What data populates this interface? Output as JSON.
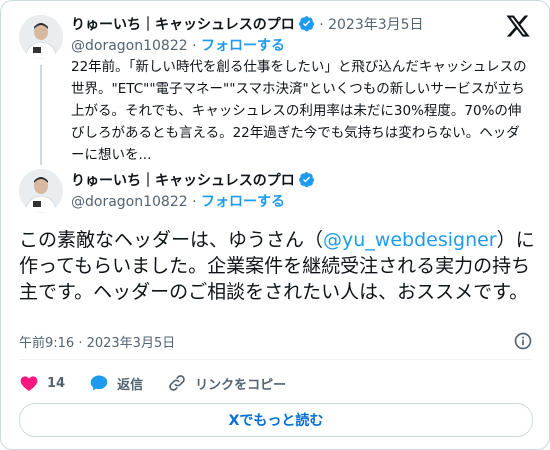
{
  "quoted": {
    "name": "りゅーいち｜キャッシュレスのプロ",
    "timestamp": "2023年3月5日",
    "handle": "@doragon10822",
    "follow_label": "フォローする",
    "text": "22年前。「新しい時代を創る仕事をしたい」と飛び込んだキャッシュレスの世界。\"ETC\"\"電子マネー\"\"スマホ決済\"といくつもの新しいサービスが立ち上がる。それでも、キャッシュレスの利用率は未だに30%程度。70%の伸びしろがあるとも言える。22年過ぎた今でも気持ちは変わらない。ヘッダーに想いを..."
  },
  "main": {
    "name": "りゅーいち｜キャッシュレスのプロ",
    "handle": "@doragon10822",
    "follow_label": "フォローする",
    "text_before": "この素敵なヘッダーは、ゆうさん（",
    "mention": "@yu_webdesigner",
    "text_after": "）に作ってもらいました。企業案件を継続受注される実力の持ち主です。ヘッダーのご相談をされたい人は、おススメです。",
    "time": "午前9:16 · 2023年3月5日"
  },
  "actions": {
    "like_count": "14",
    "reply_label": "返信",
    "copy_link_label": "リンクをコピー"
  },
  "more_button": "Xでもっと読む",
  "icons": [
    "x-logo-icon",
    "verified-badge-icon",
    "info-icon",
    "heart-icon",
    "reply-bubble-icon",
    "link-icon"
  ],
  "colors": {
    "accent": "#1d9bf0",
    "like": "#f91880",
    "muted": "#536471"
  }
}
